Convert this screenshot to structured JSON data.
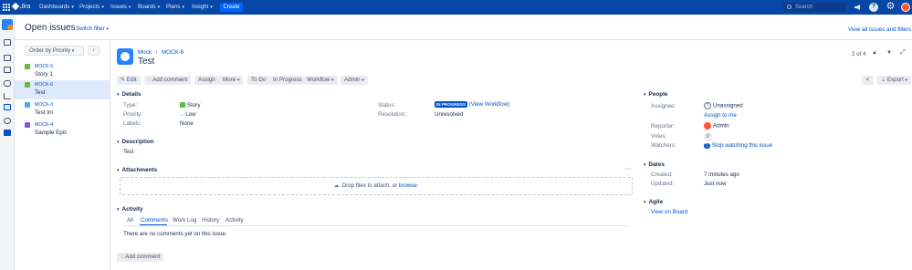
{
  "topnav": {
    "logo_text": "Jira",
    "items": [
      {
        "label": "Dashboards"
      },
      {
        "label": "Projects"
      },
      {
        "label": "Issues"
      },
      {
        "label": "Boards"
      },
      {
        "label": "Plans"
      },
      {
        "label": "Insight"
      }
    ],
    "create_label": "Create",
    "search_placeholder": "Search"
  },
  "filter": {
    "title": "Open issues",
    "switch_label": "Switch filter",
    "order_label": "Order by Priority",
    "view_all_label": "View all issues and filters"
  },
  "issue_list": [
    {
      "key": "MOCK-5",
      "title": "Story 1",
      "type": "story"
    },
    {
      "key": "MOCK-6",
      "title": "Test",
      "type": "story"
    },
    {
      "key": "MOCK-3",
      "title": "Test Ini",
      "type": "task"
    },
    {
      "key": "MOCK-4",
      "title": "Sample Epic",
      "type": "epic"
    }
  ],
  "issue": {
    "project": "Mock",
    "key": "MOCK-6",
    "summary": "Test",
    "pager": "2 of 4"
  },
  "toolbar": {
    "edit": "Edit",
    "add_comment": "Add comment",
    "assign": "Assign",
    "more": "More",
    "to_do": "To Do",
    "in_progress": "In Progress",
    "workflow": "Workflow",
    "admin": "Admin",
    "export": "Export"
  },
  "details": {
    "heading": "Details",
    "type_label": "Type:",
    "type_value": "Story",
    "priority_label": "Priority:",
    "priority_value": "Low",
    "labels_label": "Labels:",
    "labels_value": "None",
    "status_label": "Status:",
    "status_value": "IN PROGRESS",
    "view_workflow": "(View Workflow)",
    "resolution_label": "Resolution:",
    "resolution_value": "Unresolved"
  },
  "description": {
    "heading": "Description",
    "text": "Test"
  },
  "attachments": {
    "heading": "Attachments",
    "drop_text": "Drop files to attach, or",
    "browse_link": "browse."
  },
  "activity": {
    "heading": "Activity",
    "tabs": [
      "All",
      "Comments",
      "Work Log",
      "History",
      "Activity"
    ],
    "active_tab": "Comments",
    "empty_text": "There are no comments yet on this issue.",
    "add_comment": "Add comment"
  },
  "people": {
    "heading": "People",
    "assignee_label": "Assignee:",
    "assignee_value": "Unassigned",
    "assign_to_me": "Assign to me",
    "reporter_label": "Reporter:",
    "reporter_value": "Admin",
    "votes_label": "Votes:",
    "votes_value": "0",
    "watchers_label": "Watchers:",
    "watchers_count": "1",
    "stop_watching": "Stop watching this issue"
  },
  "dates": {
    "heading": "Dates",
    "created_label": "Created:",
    "created_value": "7 minutes ago",
    "updated_label": "Updated:",
    "updated_value": "Just now"
  },
  "agile": {
    "heading": "Agile",
    "view_on_board": "View on Board"
  },
  "colors": {
    "nav_bg": "#0747a6",
    "accent": "#0052cc",
    "story": "#63ba3c",
    "epic": "#904ee2",
    "status_in_progress": "#0052cc"
  }
}
